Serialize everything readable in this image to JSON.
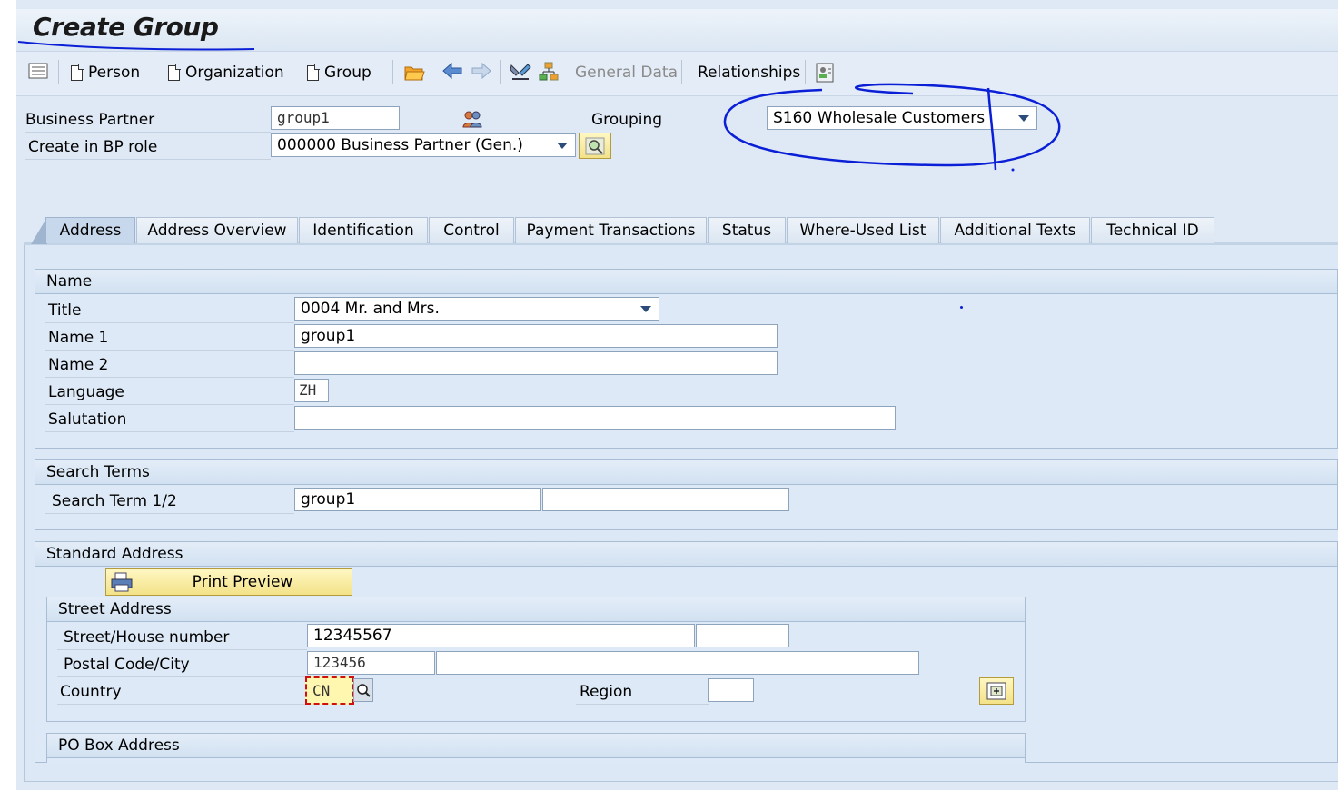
{
  "window": {
    "title": "Create Group"
  },
  "toolbar": {
    "person": "Person",
    "organization": "Organization",
    "group": "Group",
    "general_data": "General Data",
    "relationships": "Relationships"
  },
  "header": {
    "bp_label": "Business Partner",
    "bp_value": "group1",
    "grouping_label": "Grouping",
    "grouping_value": "S160 Wholesale Customers",
    "role_label": "Create in BP role",
    "role_value": "000000 Business Partner (Gen.)"
  },
  "tabs": [
    {
      "label": "Address",
      "active": true
    },
    {
      "label": "Address Overview"
    },
    {
      "label": "Identification"
    },
    {
      "label": "Control"
    },
    {
      "label": "Payment Transactions"
    },
    {
      "label": "Status"
    },
    {
      "label": "Where-Used List"
    },
    {
      "label": "Additional Texts"
    },
    {
      "label": "Technical ID"
    }
  ],
  "name_section": {
    "title": "Name",
    "title_label": "Title",
    "title_value": "0004 Mr. and Mrs.",
    "name1_label": "Name 1",
    "name1_value": "group1",
    "name2_label": "Name 2",
    "name2_value": "",
    "language_label": "Language",
    "language_value": "ZH",
    "salutation_label": "Salutation",
    "salutation_value": ""
  },
  "search_section": {
    "title": "Search Terms",
    "label": "Search Term 1/2",
    "term1": "group1",
    "term2": ""
  },
  "standard_address": {
    "title": "Standard Address",
    "print_preview": "Print Preview",
    "street_title": "Street Address",
    "street_label": "Street/House number",
    "street_value": "12345567",
    "house_value": "",
    "postal_label": "Postal Code/City",
    "postal_value": "123456",
    "city_value": "",
    "country_label": "Country",
    "country_value": "CN",
    "region_label": "Region",
    "region_value": "",
    "po_box_title": "PO Box Address"
  },
  "annotation_color": "#0a1fd6"
}
